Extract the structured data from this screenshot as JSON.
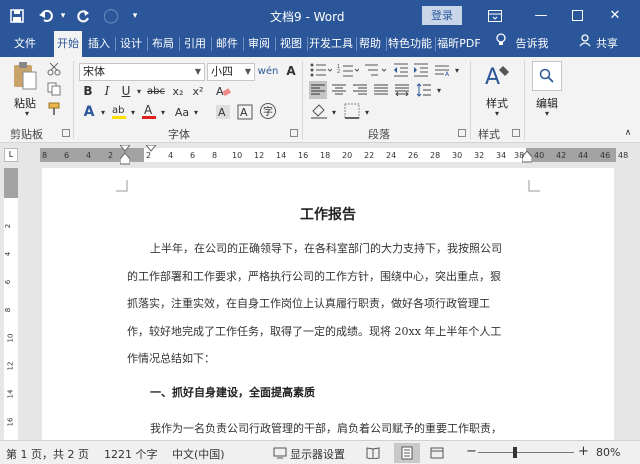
{
  "window": {
    "title": "文档9 - Word",
    "login_label": "登录",
    "minimize_glyph": "—",
    "restore_glyph": "☐",
    "close_glyph": "✕",
    "ribbon_toggle_glyph": "⊟"
  },
  "quick_access": {
    "save_glyph": "💾",
    "undo_glyph": "↶",
    "undo_dropdown_glyph": "▾",
    "redo_glyph": "↻",
    "touch_glyph": "◯",
    "customize_glyph": "▾"
  },
  "tabs": {
    "file": "文件",
    "home": "开始",
    "insert": "插入",
    "design": "设计",
    "layout": "布局",
    "references": "引用",
    "mailings": "邮件",
    "review": "审阅",
    "view": "视图",
    "developer": "开发工具",
    "help": "帮助",
    "special": "特色功能",
    "pdf": "福昕PDF",
    "tell_me": "告诉我",
    "share": "共享"
  },
  "ribbon": {
    "clipboard": {
      "paste": "粘贴",
      "group": "剪贴板"
    },
    "font": {
      "font_name": "宋体",
      "font_size": "小四",
      "group": "字体",
      "bold": "B",
      "italic": "I",
      "underline": "U",
      "strike": "abc",
      "subscript": "x₂",
      "superscript": "x²",
      "grow": "A",
      "shrink": "A",
      "case": "Aa",
      "phonetic": "wén",
      "clear": "A",
      "highlight": "ab",
      "color": "A",
      "border": "A",
      "enclose": "字"
    },
    "paragraph": {
      "group": "段落"
    },
    "styles": {
      "label": "样式",
      "group": "样式"
    },
    "editing": {
      "label": "编辑"
    }
  },
  "ruler": {
    "corner": "L",
    "numbers": [
      "8",
      "6",
      "4",
      "2",
      "2",
      "4",
      "6",
      "8",
      "10",
      "12",
      "14",
      "16",
      "18",
      "20",
      "22",
      "24",
      "26",
      "28",
      "30",
      "32",
      "34",
      "38",
      "40",
      "42",
      "44",
      "46",
      "48"
    ],
    "vnumbers": [
      "2",
      "4",
      "6",
      "8",
      "10",
      "12",
      "14",
      "16"
    ]
  },
  "document": {
    "title": "工作报告",
    "lines": [
      "上半年，在公司的正确领导下，在各科室部门的大力支持下，我按照公司",
      "的工作部署和工作要求，严格执行公司的工作方针，围绕中心，突出重点，狠",
      "抓落实，注重实效，在自身工作岗位上认真履行职责，做好各项行政管理工",
      "作，较好地完成了工作任务，取得了一定的成绩。现将 20xx 年上半年个人工",
      "作情况总结如下："
    ],
    "subheading": "一、抓好自身建设，全面提高素质",
    "partial_line": "我作为一名负责公司行政管理的干部，肩负着公司赋予的重要工作职责，"
  },
  "status": {
    "page": "第 1 页，共 2 页",
    "words": "1221 个字",
    "language": "中文(中国)",
    "display_settings": "显示器设置",
    "zoom": "80%",
    "zoom_out": "−",
    "zoom_in": "+"
  },
  "colors": {
    "accent": "#2b579a",
    "highlight_yellow": "#ffe000",
    "font_red": "#e0201c"
  }
}
